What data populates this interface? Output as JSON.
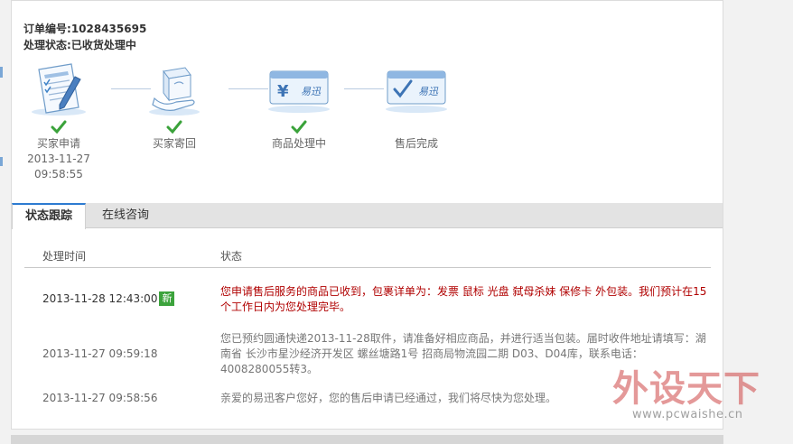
{
  "order": {
    "number_label": "订单编号:",
    "number_value": "1028435695",
    "status_label": "处理状态:",
    "status_value": "已收货处理中"
  },
  "steps": [
    {
      "label": "买家申请",
      "date": "2013-11-27",
      "time": "09:58:55",
      "done": true,
      "icon": "application-form-icon"
    },
    {
      "label": "买家寄回",
      "date": "",
      "time": "",
      "done": true,
      "icon": "package-hand-icon"
    },
    {
      "label": "商品处理中",
      "date": "",
      "time": "",
      "done": true,
      "icon": "yixun-yen-card-icon"
    },
    {
      "label": "售后完成",
      "date": "",
      "time": "",
      "done": false,
      "icon": "yixun-check-card-icon"
    }
  ],
  "tabs": [
    {
      "label": "状态跟踪",
      "active": true
    },
    {
      "label": "在线咨询",
      "active": false
    }
  ],
  "table": {
    "col_time": "处理时间",
    "col_status": "状态",
    "rows": [
      {
        "time": "2013-11-28 12:43:00",
        "badge": "新",
        "text": "您申请售后服务的商品已收到，包裹详单为：发票 鼠标 光盘 弑母杀妹 保修卡 外包装。我们预计在15个工作日内为您处理完毕。"
      },
      {
        "time": "2013-11-27 09:59:18",
        "badge": "",
        "text": "您已预约圆通快递2013-11-28取件，请准备好相应商品，并进行适当包装。届时收件地址请填写：湖南省 长沙市星沙经济开发区 螺丝塘路1号 招商局物流园二期 D03、D04库，联系电话：4008280055转3。"
      },
      {
        "time": "2013-11-27 09:58:56",
        "badge": "",
        "text": "亲爱的易迅客户您好，您的售后申请已经通过，我们将尽快为您处理。"
      }
    ]
  },
  "icon_card_text": "易迅",
  "watermark": {
    "main": "外设天下",
    "url": "www.pcwaishe.cn"
  },
  "colors": {
    "accent": "#2d7bd1",
    "alert_text": "#b00000",
    "check": "#3aa23a",
    "badge": "#3ca33c"
  }
}
